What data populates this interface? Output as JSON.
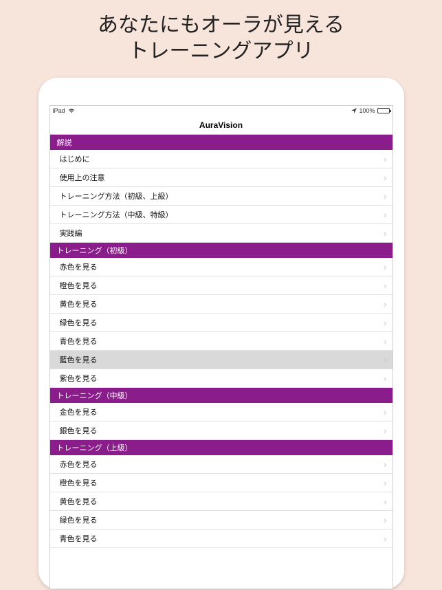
{
  "promo": {
    "line1": "あなたにもオーラが見える",
    "line2": "トレーニングアプリ"
  },
  "status": {
    "carrier": "iPad",
    "battery_pct": "100%"
  },
  "nav": {
    "title": "AuraVision"
  },
  "sections": [
    {
      "title": "解説",
      "rows": [
        {
          "label": "はじめに",
          "selected": false
        },
        {
          "label": "使用上の注意",
          "selected": false
        },
        {
          "label": "トレーニング方法（初級、上級）",
          "selected": false
        },
        {
          "label": "トレーニング方法（中級、特級）",
          "selected": false
        },
        {
          "label": "実践編",
          "selected": false
        }
      ]
    },
    {
      "title": "トレーニング（初級）",
      "rows": [
        {
          "label": "赤色を見る",
          "selected": false
        },
        {
          "label": "橙色を見る",
          "selected": false
        },
        {
          "label": "黄色を見る",
          "selected": false
        },
        {
          "label": "緑色を見る",
          "selected": false
        },
        {
          "label": "青色を見る",
          "selected": false
        },
        {
          "label": "藍色を見る",
          "selected": true
        },
        {
          "label": "紫色を見る",
          "selected": false
        }
      ]
    },
    {
      "title": "トレーニング（中級）",
      "rows": [
        {
          "label": "金色を見る",
          "selected": false
        },
        {
          "label": "銀色を見る",
          "selected": false
        }
      ]
    },
    {
      "title": "トレーニング（上級）",
      "rows": [
        {
          "label": "赤色を見る",
          "selected": false
        },
        {
          "label": "橙色を見る",
          "selected": false
        },
        {
          "label": "黄色を見る",
          "selected": false
        },
        {
          "label": "緑色を見る",
          "selected": false
        },
        {
          "label": "青色を見る",
          "selected": false
        }
      ]
    }
  ]
}
